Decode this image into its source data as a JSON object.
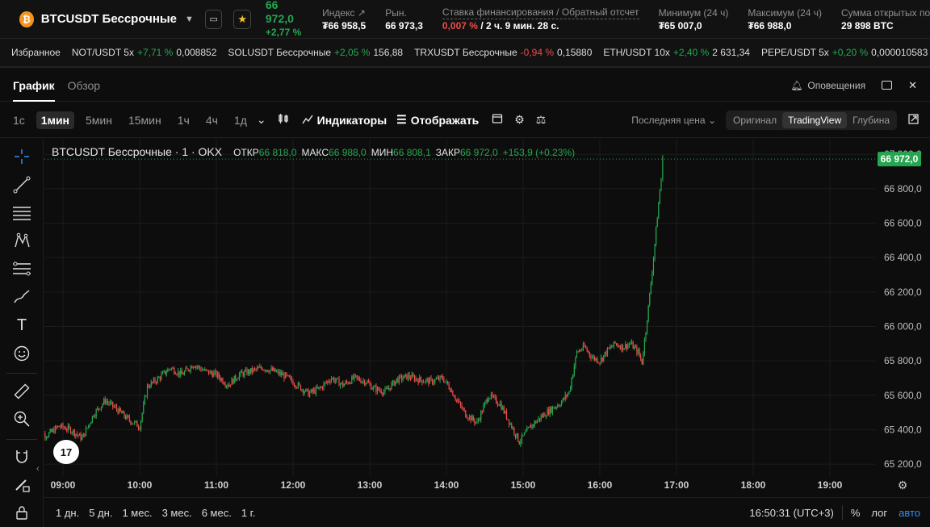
{
  "header": {
    "coin_glyph": "₿",
    "pair": "BTCUSDT Бессрочные",
    "last_price": "66 972,0",
    "change": "+2,77 %",
    "stats": [
      {
        "label": "Индекс",
        "value": "₮66 958,5"
      },
      {
        "label": "Рын.",
        "value": "66 973,3"
      },
      {
        "label": "Ставка финансирования / Обратный отсчет",
        "value_rate": "0,007 %",
        "value_rest": "/ 2 ч. 9 мин. 28 с."
      },
      {
        "label": "Минимум (24 ч)",
        "value": "₮65 007,0"
      },
      {
        "label": "Максимум (24 ч)",
        "value": "₮66 988,0"
      },
      {
        "label": "Сумма открытых позиций",
        "value": "29 898 BTC"
      }
    ]
  },
  "favorites": {
    "title": "Избранное",
    "items": [
      {
        "name": "NOT/USDT 5x",
        "pct": "+7,71 %",
        "price": "0,008852",
        "dir": "up"
      },
      {
        "name": "SOLUSDT Бессрочные",
        "pct": "+2,05 %",
        "price": "156,88",
        "dir": "up"
      },
      {
        "name": "TRXUSDT Бессрочные",
        "pct": "-0,94 %",
        "price": "0,15880",
        "dir": "down"
      },
      {
        "name": "ETH/USDT 10x",
        "pct": "+2,40 %",
        "price": "2 631,34",
        "dir": "up"
      },
      {
        "name": "PEPE/USDT 5x",
        "pct": "+0,20 %",
        "price": "0,000010583",
        "dir": "up"
      }
    ]
  },
  "tabs": {
    "chart": "График",
    "overview": "Обзор",
    "alerts": "Оповещения"
  },
  "toolbar": {
    "timeframes": [
      "1с",
      "1мин",
      "5мин",
      "15мин",
      "1ч",
      "4ч",
      "1д"
    ],
    "active_timeframe": "1мин",
    "indicators": "Индикаторы",
    "display": "Отображать",
    "price_type": "Последняя цена",
    "views": [
      "Оригинал",
      "TradingView",
      "Глубина"
    ],
    "active_view": "TradingView"
  },
  "legend": {
    "symbol": "BTCUSDT Бессрочные · 1 · OKX",
    "open_label": "ОТКР",
    "open": "66 818,0",
    "high_label": "МАКС",
    "high": "66 988,0",
    "low_label": "МИН",
    "low": "66 808,1",
    "close_label": "ЗАКР",
    "close": "66 972,0",
    "change": "+153,9 (+0.23%)"
  },
  "tv_logo": "17",
  "bottom": {
    "ranges": [
      "1 дн.",
      "5 дн.",
      "1 мес.",
      "3 мес.",
      "6 мес.",
      "1 г."
    ],
    "time": "16:50:31 (UTC+3)",
    "pct": "%",
    "log": "лог",
    "auto": "авто"
  },
  "colors": {
    "up": "#25a750",
    "down": "#f04a4a",
    "accent": "#2f8ff0",
    "coin": "#f7931a"
  },
  "chart_data": {
    "type": "line",
    "y_ticks": [
      67000,
      66800,
      66600,
      66400,
      66200,
      66000,
      65800,
      65600,
      65400,
      65200
    ],
    "y_tick_labels": [
      "67 000,0",
      "66 800,0",
      "66 600,0",
      "66 400,0",
      "66 200,0",
      "66 000,0",
      "65 800,0",
      "65 600,0",
      "65 400,0",
      "65 200,0"
    ],
    "x_ticks": [
      "09:00",
      "10:00",
      "11:00",
      "12:00",
      "13:00",
      "14:00",
      "15:00",
      "16:00",
      "17:00",
      "18:00",
      "19:00"
    ],
    "ylim": [
      65130,
      67090
    ],
    "last_price_label": "66 972,0",
    "last_price": 66972,
    "price_path": [
      [
        8.65,
        65380
      ],
      [
        8.8,
        65370
      ],
      [
        8.95,
        65420
      ],
      [
        9.1,
        65400
      ],
      [
        9.25,
        65350
      ],
      [
        9.4,
        65490
      ],
      [
        9.55,
        65570
      ],
      [
        9.7,
        65520
      ],
      [
        9.85,
        65460
      ],
      [
        10.0,
        65420
      ],
      [
        10.1,
        65650
      ],
      [
        10.25,
        65700
      ],
      [
        10.4,
        65760
      ],
      [
        10.55,
        65720
      ],
      [
        10.7,
        65780
      ],
      [
        10.85,
        65740
      ],
      [
        11.0,
        65720
      ],
      [
        11.15,
        65660
      ],
      [
        11.3,
        65720
      ],
      [
        11.45,
        65740
      ],
      [
        11.6,
        65760
      ],
      [
        11.75,
        65740
      ],
      [
        11.9,
        65710
      ],
      [
        12.05,
        65660
      ],
      [
        12.2,
        65610
      ],
      [
        12.35,
        65640
      ],
      [
        12.5,
        65700
      ],
      [
        12.65,
        65660
      ],
      [
        12.8,
        65700
      ],
      [
        12.95,
        65680
      ],
      [
        13.05,
        65640
      ],
      [
        13.2,
        65620
      ],
      [
        13.35,
        65690
      ],
      [
        13.5,
        65710
      ],
      [
        13.65,
        65690
      ],
      [
        13.8,
        65680
      ],
      [
        13.95,
        65700
      ],
      [
        14.05,
        65640
      ],
      [
        14.15,
        65560
      ],
      [
        14.25,
        65490
      ],
      [
        14.4,
        65440
      ],
      [
        14.55,
        65600
      ],
      [
        14.7,
        65550
      ],
      [
        14.85,
        65420
      ],
      [
        14.95,
        65330
      ],
      [
        15.1,
        65420
      ],
      [
        15.25,
        65480
      ],
      [
        15.4,
        65530
      ],
      [
        15.5,
        65560
      ],
      [
        15.6,
        65620
      ],
      [
        15.7,
        65850
      ],
      [
        15.8,
        65880
      ],
      [
        15.9,
        65820
      ],
      [
        16.0,
        65800
      ],
      [
        16.1,
        65860
      ],
      [
        16.2,
        65900
      ],
      [
        16.3,
        65880
      ],
      [
        16.4,
        65900
      ],
      [
        16.5,
        65850
      ],
      [
        16.55,
        65790
      ],
      [
        16.6,
        65980
      ],
      [
        16.65,
        66180
      ],
      [
        16.7,
        66400
      ],
      [
        16.75,
        66640
      ],
      [
        16.8,
        66860
      ],
      [
        16.82,
        66972
      ]
    ]
  }
}
